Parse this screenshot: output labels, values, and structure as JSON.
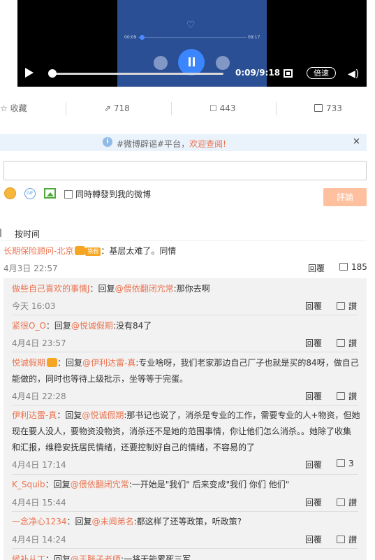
{
  "video": {
    "inner_current": "00:09",
    "inner_total": "09:17",
    "time": "0:09/9:18",
    "speed_label": "倍速",
    "progress_fraction": 0.016
  },
  "actions": {
    "favorite_label": "收藏",
    "forward_count": "718",
    "comment_count": "443",
    "like_count": "733"
  },
  "notice": {
    "prefix": "#微博辟谣#平台，",
    "highlight": "欢迎查阅!",
    "close": "×"
  },
  "comment_box": {
    "placeholder": "",
    "checkbox_label": "同時轉發到我的微博",
    "submit_label": "評論",
    "gif_text": "GIF"
  },
  "sort": {
    "label": "按时间"
  },
  "top_comment": {
    "user": "长期保险顾问-北京",
    "tag": "铁粉",
    "text": "：基层太难了。同情",
    "time": "4月3日 22:57",
    "reply": "回覆",
    "likes": "185"
  },
  "replies": [
    {
      "user": "做些自己喜欢的事情J",
      "prefix": "：回复",
      "mention": "@偎依翻闭宂常",
      "text": ":那你去啊",
      "text2": "",
      "time": "今天 16:03",
      "reply": "回覆",
      "likes": "讃"
    },
    {
      "user": "紧很O_O",
      "prefix": "：回复",
      "mention": "@悦诚假期",
      "text": ":没有84了",
      "text2": "",
      "time": "4月4日 23:57",
      "reply": "回覆",
      "likes": "讃"
    },
    {
      "user": "悦诚假期",
      "prefix": "：回复",
      "mention": "@伊利达雷-真",
      "text": ":专业啥呀，我们老家那边自己厂子也就是买的84呀，做自己",
      "text2": "能做的，同时也等待上级批示，坐等等于完蛋。",
      "time": "4月4日 22:28",
      "reply": "回覆",
      "likes": "讃"
    },
    {
      "user": "伊利达雷-真",
      "prefix": "：回复",
      "mention": "@悦诚假期",
      "text": ":那书记也说了，消杀是专业的工作，需要专业的人+物资，但她",
      "text2": "现在要人没人，要物资没物资，消杀还不是她的范围事情，你让他们怎么消杀。。她除了收集",
      "text3": "和汇报，维稳安抚居民情绪，还要控制好自己的情绪，不容易的了",
      "time": "4月4日 17:14",
      "reply": "回覆",
      "likes": "3"
    },
    {
      "user": "K_Squib",
      "prefix": "：回复",
      "mention": "@偎依翻闭宂常",
      "text": ":一开始是\"我们\" 后来变成\"我们 你们 他们\"",
      "text2": "",
      "time": "4月4日 15:44",
      "reply": "回覆",
      "likes": "讃"
    },
    {
      "user": "一念净心1234",
      "prefix": "：回复",
      "mention": "@未闻弟名",
      "text": ":都这样了还等政策，听政策?",
      "text2": "",
      "time": "4月4日 14:24",
      "reply": "回覆",
      "likes": "讃"
    },
    {
      "user": "候补从丁",
      "prefix": "：回复",
      "mention": "@王胖子老师",
      "text": ":一将无能累死三军",
      "text2": "",
      "time": "",
      "reply": "",
      "likes": ""
    }
  ]
}
